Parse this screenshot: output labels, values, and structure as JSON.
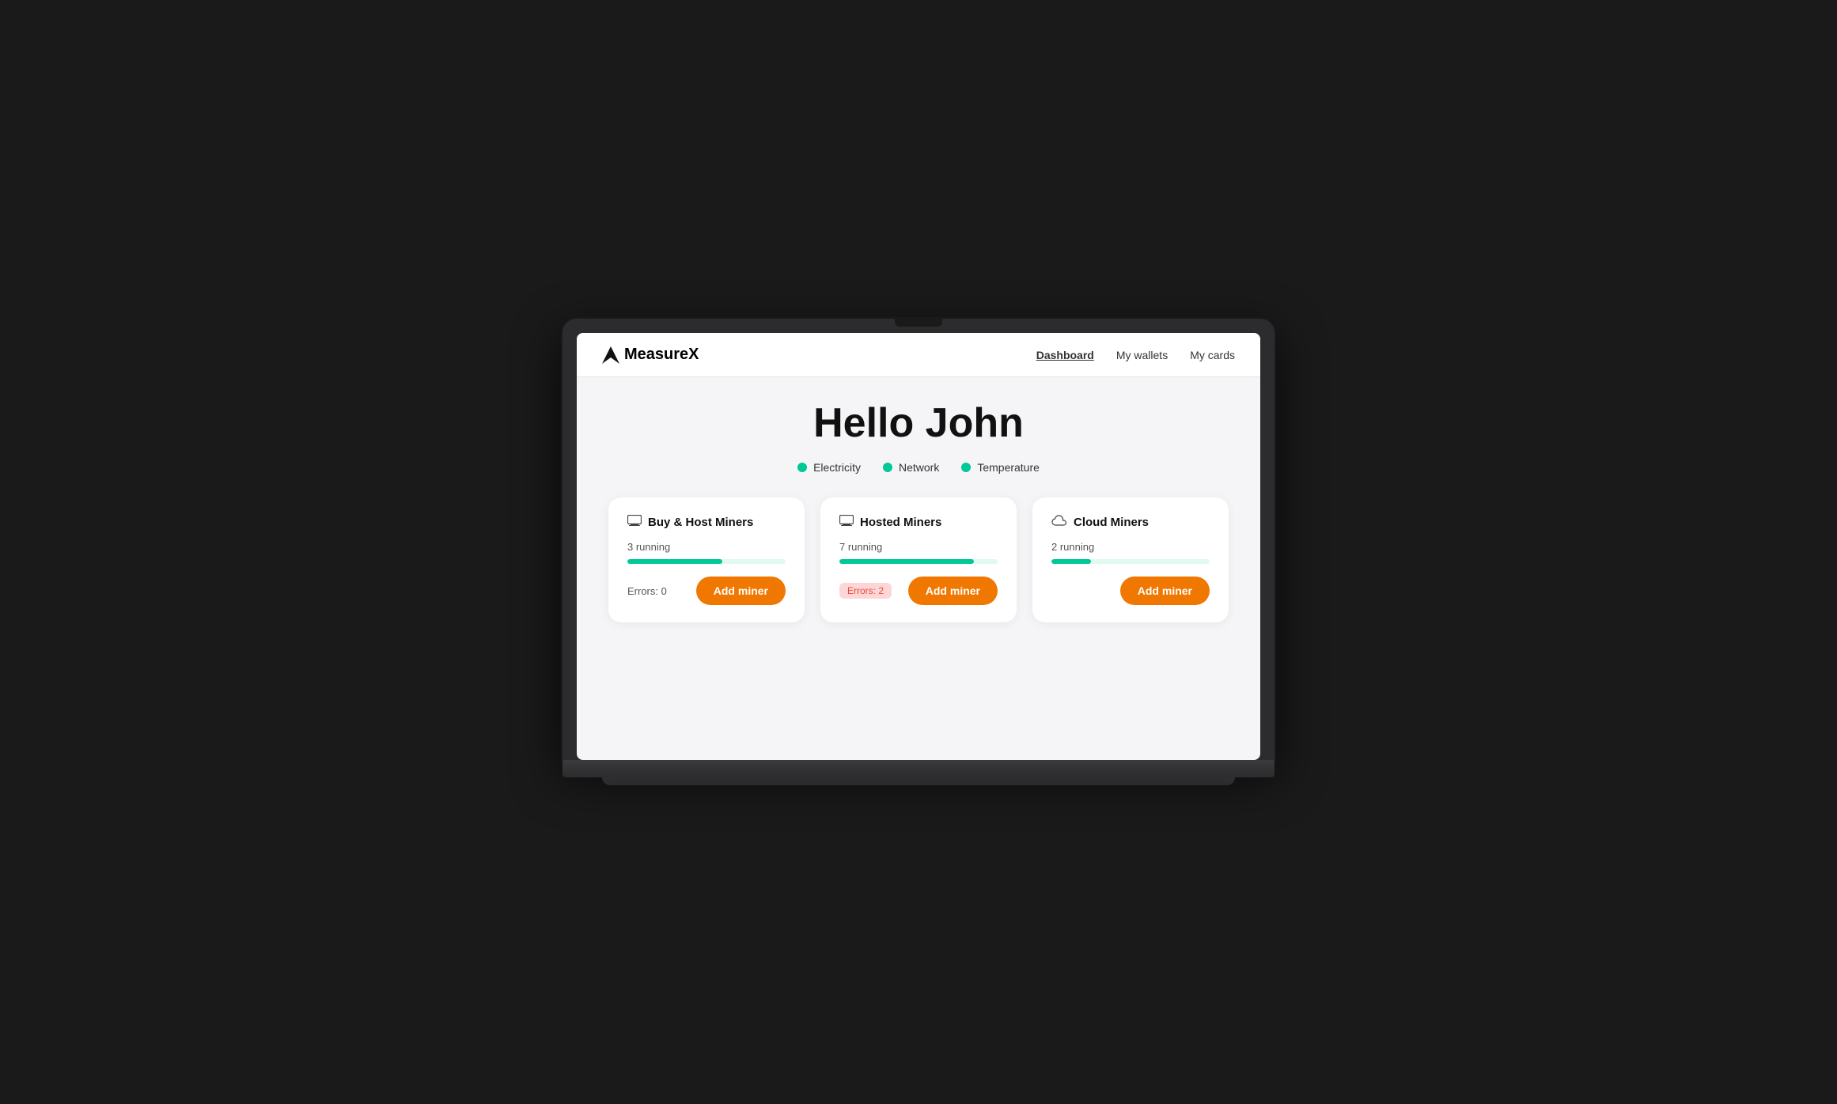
{
  "brand": {
    "name": "MeasureX",
    "logo_unicode": "◢"
  },
  "nav": {
    "items": [
      {
        "label": "Dashboard",
        "active": true
      },
      {
        "label": "My wallets",
        "active": false
      },
      {
        "label": "My cards",
        "active": false
      }
    ]
  },
  "greeting": "Hello John",
  "status_indicators": [
    {
      "label": "Electricity",
      "color": "#00c896"
    },
    {
      "label": "Network",
      "color": "#00c896"
    },
    {
      "label": "Temperature",
      "color": "#00c896"
    }
  ],
  "cards": [
    {
      "title": "Buy & Host Miners",
      "icon": "🖥",
      "running_count": "3 running",
      "progress_pct": 60,
      "errors_label": "Errors: 0",
      "errors_count": 0,
      "add_btn_label": "Add miner"
    },
    {
      "title": "Hosted Miners",
      "icon": "🖥",
      "running_count": "7 running",
      "progress_pct": 85,
      "errors_label": "Errors: 2",
      "errors_count": 2,
      "add_btn_label": "Add miner"
    },
    {
      "title": "Cloud Miners",
      "icon": "☁",
      "running_count": "2 running",
      "progress_pct": 25,
      "errors_label": "",
      "errors_count": 0,
      "add_btn_label": "Add miner"
    }
  ]
}
